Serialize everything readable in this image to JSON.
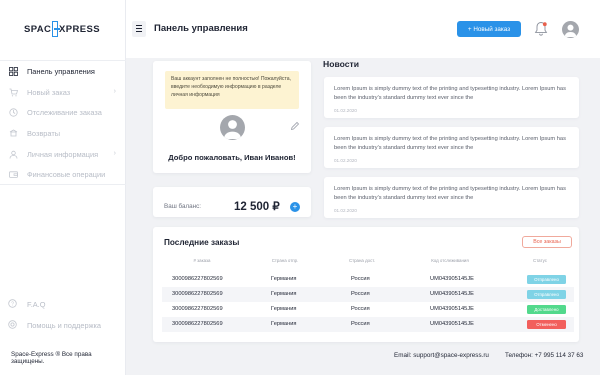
{
  "logo": {
    "left": "SPAC",
    "right": "XPRESS"
  },
  "sidebar": {
    "items": [
      {
        "label": "Панель управления",
        "icon": "dashboard-icon"
      },
      {
        "label": "Новый заказ",
        "icon": "cart-icon"
      },
      {
        "label": "Отслеживание заказа",
        "icon": "tracking-icon"
      },
      {
        "label": "Возвраты",
        "icon": "return-icon"
      },
      {
        "label": "Личная информация",
        "icon": "user-icon"
      },
      {
        "label": "Финансовые операции",
        "icon": "wallet-icon"
      }
    ],
    "faq": "F.A.Q",
    "support": "Помощь и поддержка",
    "copyright": "Space-Express ® Все права защищены."
  },
  "header": {
    "title": "Панель управления",
    "new_order": "+  Новый заказ"
  },
  "profile": {
    "warning": "Ваш аккаунт заполнен не полностью! Пожалуйста, введите необходимую информацию в разделе личная информация",
    "welcome": "Добро пожаловать, Иван Иванов!"
  },
  "balance": {
    "label": "Ваш баланс:",
    "value": "12 500 ₽",
    "add": "+"
  },
  "news": {
    "title": "Новости",
    "items": [
      {
        "text": "Lorem Ipsum is simply dummy text of the printing and typesetting industry. Lorem Ipsum has been the industry's standard dummy text ever since the",
        "date": "01.02.2020"
      },
      {
        "text": "Lorem Ipsum is simply dummy text of the printing and typesetting industry. Lorem Ipsum has been the industry's standard dummy text ever since the",
        "date": "01.02.2020"
      },
      {
        "text": "Lorem Ipsum is simply dummy text of the printing and typesetting industry. Lorem Ipsum has been the industry's standard dummy text ever since the",
        "date": "01.02.2020"
      }
    ]
  },
  "orders": {
    "title": "Последние заказы",
    "all_button": "Все заказы",
    "columns": [
      "# заказа",
      "Страна отпр.",
      "Страна дост.",
      "Код отслеживания",
      "Статус"
    ],
    "rows": [
      {
        "id": "3000986227802569",
        "from": "Германия",
        "to": "Россия",
        "code": "UM043905145JE",
        "status": "Отправлено",
        "status_color": "#7fd3e6"
      },
      {
        "id": "3000986227802569",
        "from": "Германия",
        "to": "Россия",
        "code": "UM043905145JE",
        "status": "Отправлено",
        "status_color": "#7fd3e6"
      },
      {
        "id": "3000986227802569",
        "from": "Германия",
        "to": "Россия",
        "code": "UM043905145JE",
        "status": "Доставлено",
        "status_color": "#52d98c"
      },
      {
        "id": "3000986227802569",
        "from": "Германия",
        "to": "Россия",
        "code": "UM043905145JE",
        "status": "Отменено",
        "status_color": "#f25f5c"
      }
    ]
  },
  "footer": {
    "email": "Email:  support@space-express.ru",
    "phone": "Телефон: +7 995 114 37 63"
  },
  "colors": {
    "accent": "#2a92e8",
    "warning_bg": "#fdf3d2",
    "danger": "#e8604c"
  }
}
